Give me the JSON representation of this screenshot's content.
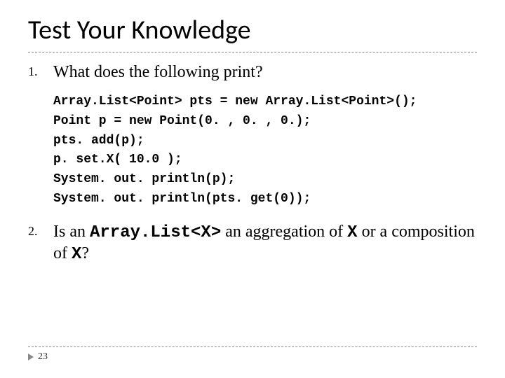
{
  "title": "Test Your Knowledge",
  "items": {
    "q1": {
      "num": "1.",
      "text": "What does the following print?",
      "code": "Array.List<Point> pts = new Array.List<Point>();\nPoint p = new Point(0. , 0. , 0.);\npts. add(p);\np. set.X( 10.0 );\nSystem. out. println(p);\nSystem. out. println(pts. get(0));"
    },
    "q2": {
      "num": "2.",
      "text_before": "Is an ",
      "mono1": "Array.List<X>",
      "text_mid": " an aggregation of ",
      "mono2": "X",
      "text_mid2": " or a composition of ",
      "mono3": "X",
      "text_after": "?"
    }
  },
  "page_number": "23"
}
